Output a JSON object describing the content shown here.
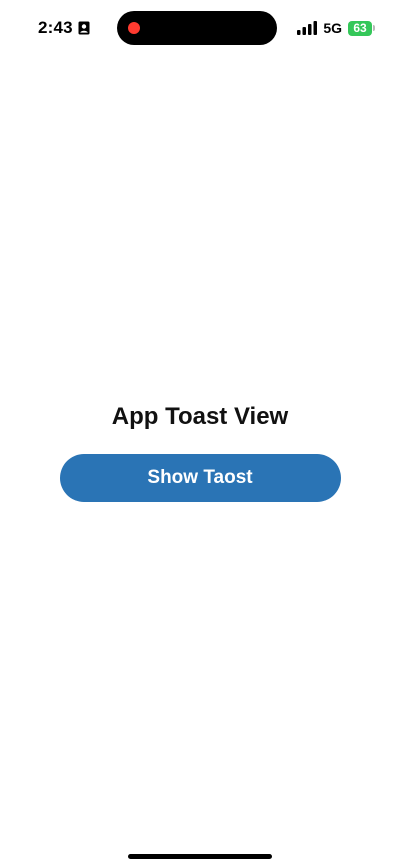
{
  "status_bar": {
    "time": "2:43",
    "network": "5G",
    "battery_level": "63",
    "icons": {
      "id": "contact-card-icon",
      "signal": "cellular-signal-icon",
      "battery": "battery-charging-icon",
      "recording": "screen-recording-indicator"
    },
    "colors": {
      "recording": "#ff3b30",
      "battery": "#34c759"
    }
  },
  "main": {
    "title": "App Toast View",
    "show_toast_label": "Show Taost",
    "accent": "#2a74b5"
  }
}
